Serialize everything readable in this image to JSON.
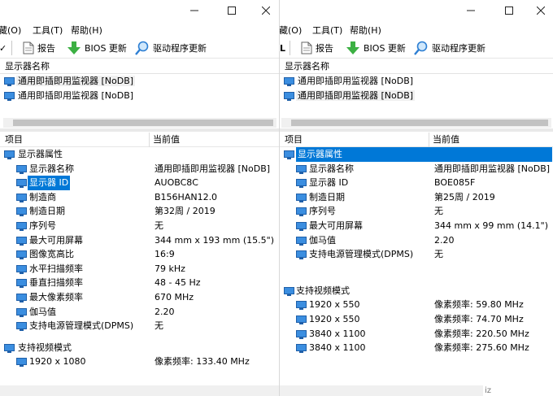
{
  "left": {
    "menu": [
      "藏(O)",
      "工具(T)",
      "帮助(H)"
    ],
    "toolbar": {
      "partial": "✓",
      "report": "报告",
      "bios": "BIOS 更新",
      "driver": "驱动程序更新"
    },
    "list_header": "显示器名称",
    "monitors": [
      "通用即插即用监视器 [NoDB]",
      "通用即插即用监视器 [NoDB]"
    ],
    "columns": [
      "项目",
      "当前值"
    ],
    "group1": "显示器属性",
    "properties": [
      {
        "name": "显示器名称",
        "value": "通用即插即用监视器 [NoDB]"
      },
      {
        "name": "显示器 ID",
        "value": "AUOBC8C"
      },
      {
        "name": "制造商",
        "value": "B156HAN12.0"
      },
      {
        "name": "制造日期",
        "value": "第32周 / 2019"
      },
      {
        "name": "序列号",
        "value": "无"
      },
      {
        "name": "最大可用屏幕",
        "value": "344 mm x 193 mm (15.5\")"
      },
      {
        "name": "图像宽高比",
        "value": "16:9"
      },
      {
        "name": "水平扫描频率",
        "value": "79 kHz"
      },
      {
        "name": "垂直扫描频率",
        "value": "48 - 45 Hz"
      },
      {
        "name": "最大像素频率",
        "value": "670 MHz"
      },
      {
        "name": "伽马值",
        "value": "2.20"
      },
      {
        "name": "支持电源管理模式(DPMS)",
        "value": "无"
      }
    ],
    "group2": "支持视频模式",
    "modes": [
      {
        "name": "1920 x 1080",
        "value": "像素频率: 133.40 MHz"
      }
    ]
  },
  "right": {
    "menu": [
      "藏(O)",
      "工具(T)",
      "帮助(H)"
    ],
    "toolbar": {
      "partial": "L",
      "report": "报告",
      "bios": "BIOS 更新",
      "driver": "驱动程序更新"
    },
    "list_header": "显示器名称",
    "monitors": [
      "通用即插即用监视器 [NoDB]",
      "通用即插即用监视器 [NoDB]"
    ],
    "columns": [
      "项目",
      "当前值"
    ],
    "group1": "显示器属性",
    "properties": [
      {
        "name": "显示器名称",
        "value": "通用即插即用监视器 [NoDB]"
      },
      {
        "name": "显示器 ID",
        "value": "BOE085F"
      },
      {
        "name": "制造日期",
        "value": "第25周 / 2019"
      },
      {
        "name": "序列号",
        "value": "无"
      },
      {
        "name": "最大可用屏幕",
        "value": "344 mm x 99 mm (14.1\")"
      },
      {
        "name": "伽马值",
        "value": "2.20"
      },
      {
        "name": "支持电源管理模式(DPMS)",
        "value": "无"
      }
    ],
    "group2": "支持视频模式",
    "modes": [
      {
        "name": "1920 x 550",
        "value": "像素频率: 59.80 MHz"
      },
      {
        "name": "1920 x 550",
        "value": "像素频率: 74.70 MHz"
      },
      {
        "name": "3840 x 1100",
        "value": "像素频率: 220.50 MHz"
      },
      {
        "name": "3840 x 1100",
        "value": "像素频率: 275.60 MHz"
      }
    ],
    "bottom_fragment": "iz"
  },
  "colors": {
    "selection": "#0078d7",
    "monitor_icon": "#2d7fd3",
    "bios_arrow": "#3cb043"
  }
}
